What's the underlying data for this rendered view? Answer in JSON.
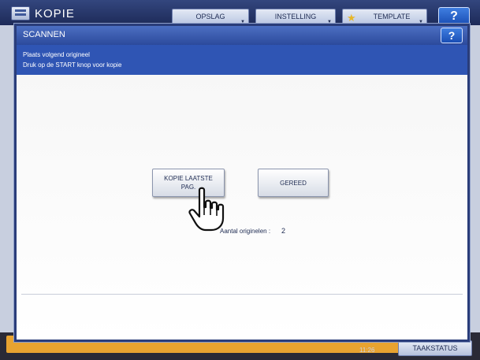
{
  "app": {
    "title": "KOPIE",
    "tabs": [
      {
        "label": "OPSLAG"
      },
      {
        "label": "INSTELLING"
      },
      {
        "label": "TEMPLATE"
      }
    ],
    "help_label": "?"
  },
  "dialog": {
    "title": "SCANNEN",
    "help_label": "?",
    "message_line1": "Plaats volgend origineel",
    "message_line2": "Druk op de START knop voor kopie",
    "buttons": {
      "kopie_line1": "KOPIE LAATSTE",
      "kopie_line2": "PAG.",
      "gereed": "GEREED"
    },
    "originals_label": "Aantal originelen :",
    "originals_value": "2"
  },
  "footer": {
    "time": "11:26",
    "status_button": "TAAKSTATUS"
  },
  "colors": {
    "title_bar": "#2c4a9c",
    "message_bar": "#2f55b4",
    "help_button": "#1a4eb5",
    "accent_orange": "#e8a330"
  }
}
